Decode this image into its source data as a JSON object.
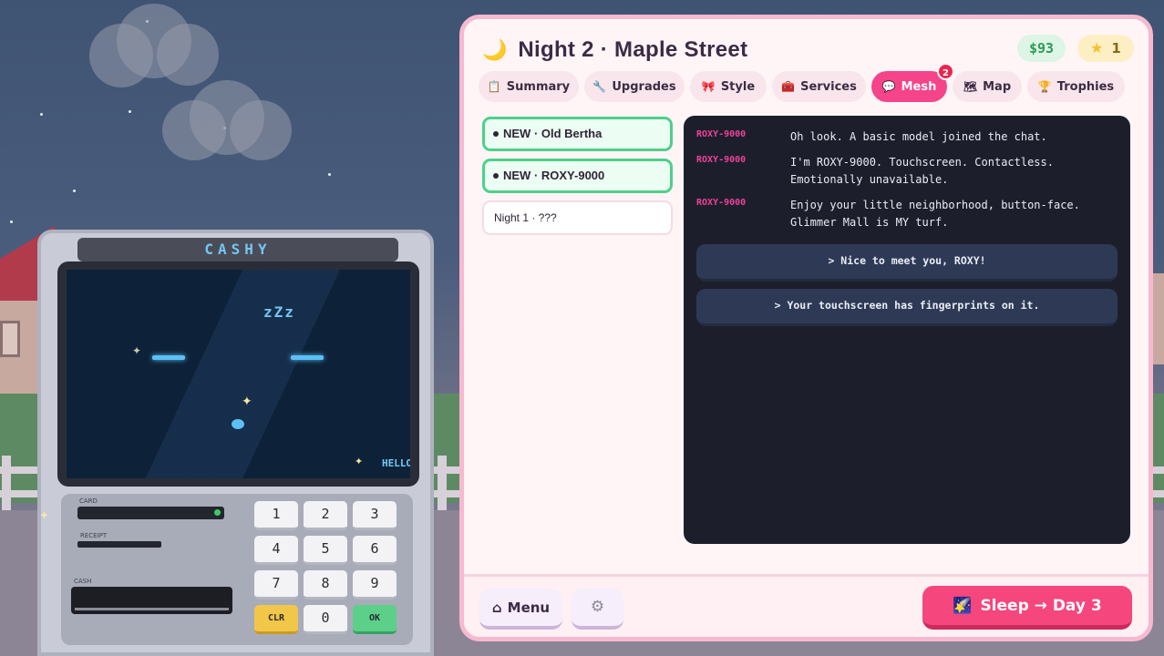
{
  "header": {
    "title": "Night 2 · Maple Street",
    "money": "$93",
    "stars": "1"
  },
  "tabs": [
    {
      "label": "Summary",
      "icon": "clipboard-icon"
    },
    {
      "label": "Upgrades",
      "icon": "wrench-icon"
    },
    {
      "label": "Style",
      "icon": "ribbon-icon"
    },
    {
      "label": "Services",
      "icon": "toolbox-icon"
    },
    {
      "label": "Mesh",
      "icon": "speech-bubble-icon",
      "active": true,
      "badge": "2"
    },
    {
      "label": "Map",
      "icon": "map-icon"
    },
    {
      "label": "Trophies",
      "icon": "trophy-icon"
    }
  ],
  "threads": [
    {
      "label": "NEW · Old Bertha",
      "is_new": true
    },
    {
      "label": "NEW · ROXY-9000",
      "is_new": true
    },
    {
      "label": "Night 1 · ???",
      "is_new": false
    }
  ],
  "chat": {
    "messages": [
      {
        "sender": "ROXY-9000",
        "text": "Oh look. A basic model joined the chat."
      },
      {
        "sender": "ROXY-9000",
        "text": "I'm ROXY-9000. Touchscreen. Contactless. Emotionally unavailable."
      },
      {
        "sender": "ROXY-9000",
        "text": "Enjoy your little neighborhood, button-face. Glimmer Mall is MY turf."
      }
    ],
    "replies": [
      "> Nice to meet you, ROXY!",
      "> Your touchscreen has fingerprints on it."
    ]
  },
  "footer": {
    "menu_label": "Menu",
    "sleep_label": "Sleep → Day 3"
  },
  "atm": {
    "sign": "CASHY",
    "screen_text": "zZz",
    "ticker": "HELLO",
    "card_label": "CARD",
    "receipt_label": "RECEIPT",
    "cash_label": "CASH",
    "keys": [
      "1",
      "2",
      "3",
      "4",
      "5",
      "6",
      "7",
      "8",
      "9",
      "CLR",
      "0",
      "OK"
    ]
  },
  "colors": {
    "accent_pink": "#f5448a",
    "new_thread_green": "#4ed089",
    "chat_bg": "#1c1f2b",
    "sender_pink": "#f0409a",
    "screen_blue": "#5cc0f5"
  }
}
